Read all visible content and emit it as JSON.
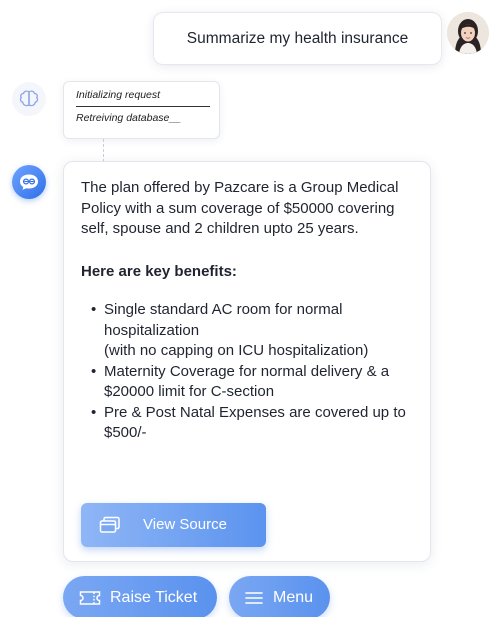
{
  "user_message": {
    "text": "Summarize my health insurance"
  },
  "status": {
    "step1": "Initializing request",
    "step2": "Retreiving database__"
  },
  "answer": {
    "intro": "The plan offered by Pazcare is a Group Medical Policy with a sum coverage of $50000 covering self, spouse and 2 children upto 25 years.",
    "benefits_heading": "Here are key benefits:",
    "benefits": [
      {
        "line1": "Single standard AC room for normal hospitalization",
        "line2": "(with no capping on ICU hospitalization)"
      },
      {
        "line1": "Maternity Coverage for normal delivery & a $20000 limit for C-section"
      },
      {
        "line1": "Pre & Post Natal Expenses are covered up to $500/-"
      }
    ],
    "view_source_label": "View Source"
  },
  "actions": {
    "raise_ticket_label": "Raise Ticket",
    "menu_label": "Menu"
  },
  "colors": {
    "accent": "#5b93ef",
    "accent_light": "#8fb6f6",
    "text": "#1f2430"
  },
  "icons": [
    "avatar",
    "brain-icon",
    "bot-chat-icon",
    "window-stack-icon",
    "ticket-icon",
    "hamburger-menu-icon"
  ]
}
